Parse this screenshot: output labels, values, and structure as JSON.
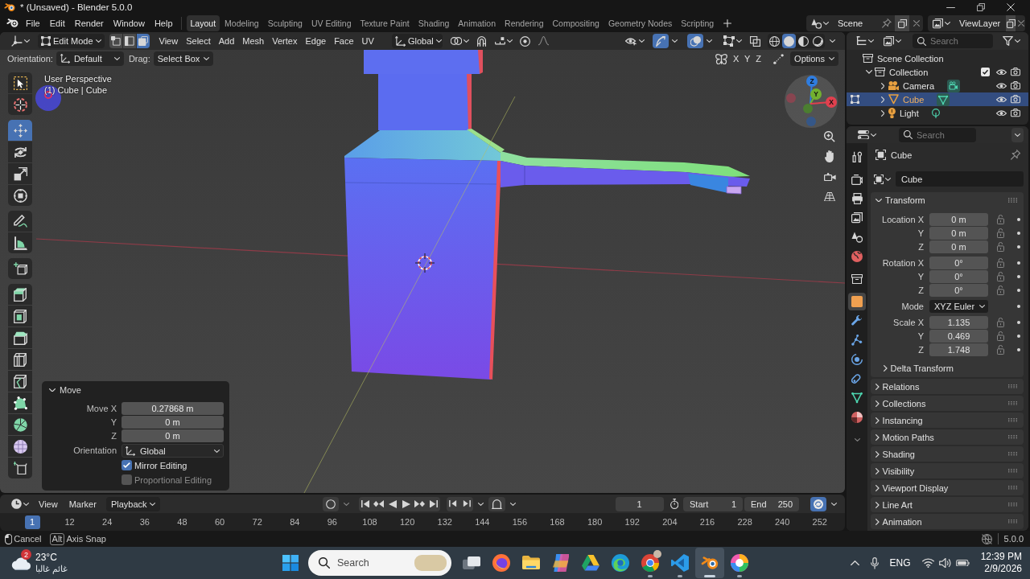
{
  "window": {
    "title": "* (Unsaved) - Blender 5.0.0"
  },
  "top_bar": {
    "menus": [
      "File",
      "Edit",
      "Render",
      "Window",
      "Help"
    ],
    "workspaces": [
      {
        "label": "Layout",
        "selected": true
      },
      {
        "label": "Modeling",
        "selected": false
      },
      {
        "label": "Sculpting",
        "selected": false
      },
      {
        "label": "UV Editing",
        "selected": false
      },
      {
        "label": "Texture Paint",
        "selected": false
      },
      {
        "label": "Shading",
        "selected": false
      },
      {
        "label": "Animation",
        "selected": false
      },
      {
        "label": "Rendering",
        "selected": false
      },
      {
        "label": "Compositing",
        "selected": false
      },
      {
        "label": "Geometry Nodes",
        "selected": false
      },
      {
        "label": "Scripting",
        "selected": false
      }
    ],
    "scene": "Scene",
    "view_layer": "ViewLayer"
  },
  "viewport": {
    "header": {
      "mode": "Edit Mode",
      "select_modes": [
        {
          "kind": "vertex",
          "selected": false
        },
        {
          "kind": "edge",
          "selected": false
        },
        {
          "kind": "face",
          "selected": true
        }
      ],
      "menus": [
        "View",
        "Select",
        "Add",
        "Mesh",
        "Vertex",
        "Edge",
        "Face",
        "UV"
      ],
      "orientation": "Global",
      "snap": {
        "on": false
      },
      "proportional_editing": {
        "on": false
      },
      "gizmos": {
        "on": true
      },
      "overlays": {
        "on": true
      },
      "xray": {
        "on": false
      },
      "shading": [
        {
          "kind": "wireframe",
          "selected": false
        },
        {
          "kind": "solid",
          "selected": true
        },
        {
          "kind": "material",
          "selected": false
        },
        {
          "kind": "rendered",
          "selected": false
        }
      ]
    },
    "tool_settings": {
      "orientation_label": "Orientation:",
      "orientation": "Default",
      "drag_label": "Drag:",
      "drag": "Select Box",
      "mirror_axes": [
        {
          "label": "X",
          "on": false
        },
        {
          "label": "Y",
          "on": false
        },
        {
          "label": "Z",
          "on": false
        }
      ],
      "options": "Options"
    },
    "info": {
      "view": "User Perspective",
      "object": "(1) Cube | Cube"
    },
    "tool_groups": [
      [
        {
          "kind": "select-box",
          "selected": false
        },
        {
          "kind": "cursor",
          "selected": false
        }
      ],
      [
        {
          "kind": "move",
          "selected": true
        },
        {
          "kind": "rotate",
          "selected": false
        },
        {
          "kind": "scale",
          "selected": false
        },
        {
          "kind": "transform",
          "selected": false
        }
      ],
      [
        {
          "kind": "annotate",
          "selected": false
        },
        {
          "kind": "measure",
          "selected": false
        }
      ],
      [
        {
          "kind": "add-cube",
          "selected": false
        }
      ],
      [
        {
          "kind": "extrude",
          "selected": false
        },
        {
          "kind": "inset",
          "selected": false
        },
        {
          "kind": "bevel",
          "selected": false
        },
        {
          "kind": "loop-cut",
          "selected": false
        },
        {
          "kind": "knife",
          "selected": false
        },
        {
          "kind": "poly-build",
          "selected": false
        },
        {
          "kind": "spin",
          "selected": false
        },
        {
          "kind": "smooth",
          "selected": false
        },
        {
          "kind": "shear",
          "selected": false
        }
      ]
    ],
    "gizmo_axes": [
      "Z",
      "Y",
      "X"
    ],
    "last_operator": {
      "title": "Move",
      "expanded": true,
      "fields": [
        {
          "label": "Move X",
          "value": "0.27868 m"
        },
        {
          "label": "Y",
          "value": "0 m"
        },
        {
          "label": "Z",
          "value": "0 m"
        }
      ],
      "orientation_label": "Orientation",
      "orientation": "Global",
      "options": [
        {
          "label": "Mirror Editing",
          "checked": true,
          "disabled": false
        },
        {
          "label": "Proportional Editing",
          "checked": false,
          "disabled": true
        }
      ]
    }
  },
  "timeline": {
    "menus": [
      "View",
      "Marker"
    ],
    "playback": "Playback",
    "current_frame": "1",
    "start_label": "Start",
    "start": "1",
    "end_label": "End",
    "end": "250",
    "frames": [
      {
        "label": "1",
        "selected": true
      },
      {
        "label": "12",
        "selected": false
      },
      {
        "label": "24",
        "selected": false
      },
      {
        "label": "36",
        "selected": false
      },
      {
        "label": "48",
        "selected": false
      },
      {
        "label": "60",
        "selected": false
      },
      {
        "label": "72",
        "selected": false
      },
      {
        "label": "84",
        "selected": false
      },
      {
        "label": "96",
        "selected": false
      },
      {
        "label": "108",
        "selected": false
      },
      {
        "label": "120",
        "selected": false
      },
      {
        "label": "132",
        "selected": false
      },
      {
        "label": "144",
        "selected": false
      },
      {
        "label": "156",
        "selected": false
      },
      {
        "label": "168",
        "selected": false
      },
      {
        "label": "180",
        "selected": false
      },
      {
        "label": "192",
        "selected": false
      },
      {
        "label": "204",
        "selected": false
      },
      {
        "label": "216",
        "selected": false
      },
      {
        "label": "228",
        "selected": false
      },
      {
        "label": "240",
        "selected": false
      },
      {
        "label": "252",
        "selected": false
      }
    ]
  },
  "outliner": {
    "search": {
      "placeholder": "Search"
    },
    "tree": [
      {
        "label": "Scene Collection",
        "kind": "scene-collection",
        "selected": false,
        "children": [
          {
            "label": "Collection",
            "kind": "collection",
            "selected": false,
            "expanded": true,
            "checked": true,
            "visible": true,
            "renderable": true,
            "children": [
              {
                "label": "Camera",
                "kind": "camera",
                "selected": false,
                "expanded": false,
                "in_edit_mode": false,
                "visible": true,
                "renderable": true
              },
              {
                "label": "Cube",
                "kind": "mesh",
                "selected": true,
                "expanded": false,
                "in_edit_mode": true,
                "visible": true,
                "renderable": true
              },
              {
                "label": "Light",
                "kind": "light",
                "selected": false,
                "expanded": false,
                "in_edit_mode": false,
                "visible": true,
                "renderable": true
              }
            ]
          }
        ]
      }
    ]
  },
  "properties": {
    "search": {
      "placeholder": "Search"
    },
    "tab_groups": [
      [
        {
          "kind": "tool",
          "selected": false
        }
      ],
      [
        {
          "kind": "render",
          "selected": false
        },
        {
          "kind": "output",
          "selected": false
        },
        {
          "kind": "view-layer",
          "selected": false
        },
        {
          "kind": "scene",
          "selected": false
        },
        {
          "kind": "world",
          "selected": false
        }
      ],
      [
        {
          "kind": "collection",
          "selected": false
        }
      ],
      [
        {
          "kind": "object",
          "selected": true
        },
        {
          "kind": "modifiers",
          "selected": false
        },
        {
          "kind": "particles",
          "selected": false
        },
        {
          "kind": "physics",
          "selected": false
        },
        {
          "kind": "constraints",
          "selected": false
        },
        {
          "kind": "data",
          "selected": false
        },
        {
          "kind": "material",
          "selected": false
        }
      ]
    ],
    "object_name": "Cube",
    "data_name": "Cube",
    "transform": {
      "title": "Transform",
      "expanded": true,
      "groups": [
        [
          {
            "kind": "number",
            "label": "Location X",
            "value": "0 m",
            "locked": false
          },
          {
            "kind": "number",
            "label": "Y",
            "value": "0 m",
            "locked": false
          },
          {
            "kind": "number",
            "label": "Z",
            "value": "0 m",
            "locked": false
          }
        ],
        [
          {
            "kind": "number",
            "label": "Rotation X",
            "value": "0°",
            "locked": false
          },
          {
            "kind": "number",
            "label": "Y",
            "value": "0°",
            "locked": false
          },
          {
            "kind": "number",
            "label": "Z",
            "value": "0°",
            "locked": false
          }
        ],
        [
          {
            "kind": "dropdown",
            "label": "Mode",
            "value": "XYZ Euler"
          }
        ],
        [
          {
            "kind": "number",
            "label": "Scale X",
            "value": "1.135",
            "locked": false
          },
          {
            "kind": "number",
            "label": "Y",
            "value": "0.469",
            "locked": false
          },
          {
            "kind": "number",
            "label": "Z",
            "value": "1.748",
            "locked": false
          }
        ]
      ],
      "subpanels": [
        {
          "title": "Delta Transform",
          "expanded": false
        }
      ]
    },
    "panels": [
      {
        "title": "Relations",
        "expanded": false
      },
      {
        "title": "Collections",
        "expanded": false
      },
      {
        "title": "Instancing",
        "expanded": false
      },
      {
        "title": "Motion Paths",
        "expanded": false
      },
      {
        "title": "Shading",
        "expanded": false
      },
      {
        "title": "Visibility",
        "expanded": false
      },
      {
        "title": "Viewport Display",
        "expanded": false
      },
      {
        "title": "Line Art",
        "expanded": false
      },
      {
        "title": "Animation",
        "expanded": false
      }
    ]
  },
  "status_bar": {
    "hints": [
      {
        "kind": "mouse",
        "label": "Cancel"
      },
      {
        "kind": "key",
        "key": "Alt",
        "label": "Axis Snap"
      }
    ],
    "version": "5.0.0"
  },
  "taskbar": {
    "weather": {
      "badge": "2",
      "temperature": "23°C",
      "condition": "غائم غالبا"
    },
    "search": {
      "placeholder": "Search"
    },
    "apps": [
      {
        "kind": "task-view",
        "running": false,
        "selected": false
      },
      {
        "kind": "firefox",
        "running": false,
        "selected": false
      },
      {
        "kind": "files",
        "running": false,
        "selected": false
      },
      {
        "kind": "copilot",
        "running": false,
        "selected": false
      },
      {
        "kind": "drive",
        "running": false,
        "selected": false
      },
      {
        "kind": "edge",
        "running": false,
        "selected": false
      },
      {
        "kind": "chrome",
        "running": true,
        "selected": false
      },
      {
        "kind": "vscode",
        "running": true,
        "selected": false
      },
      {
        "kind": "blender",
        "running": true,
        "selected": true
      },
      {
        "kind": "photos",
        "running": true,
        "selected": false
      }
    ],
    "language": "ENG",
    "time": "12:39 PM",
    "date": "2/9/2026"
  }
}
